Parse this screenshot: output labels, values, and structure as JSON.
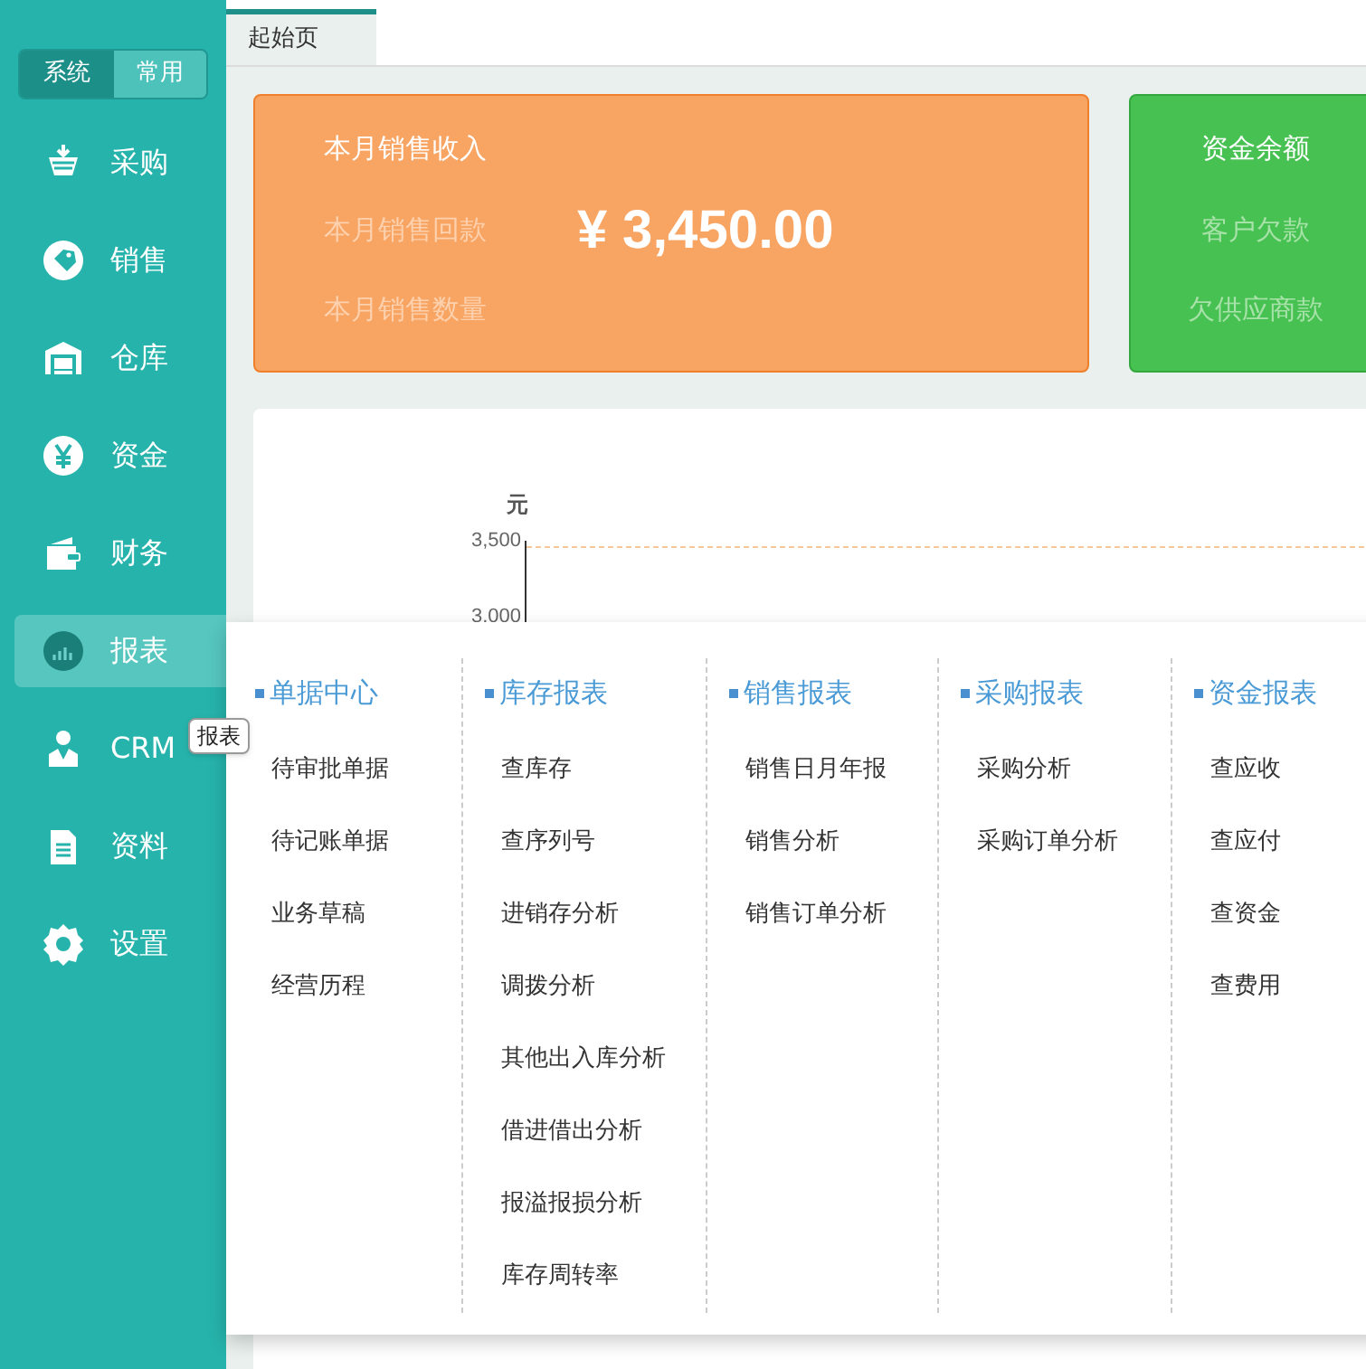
{
  "mode_switch": [
    {
      "label": "系统",
      "selected": true
    },
    {
      "label": "常用",
      "selected": false
    }
  ],
  "nav": [
    {
      "label": "采购",
      "selected": false
    },
    {
      "label": "销售",
      "selected": false
    },
    {
      "label": "仓库",
      "selected": false
    },
    {
      "label": "资金",
      "selected": false
    },
    {
      "label": "财务",
      "selected": false
    },
    {
      "label": "报表",
      "selected": true
    },
    {
      "label": "CRM",
      "selected": false
    },
    {
      "label": "资料",
      "selected": false
    },
    {
      "label": "设置",
      "selected": false
    }
  ],
  "tooltip": "报表",
  "page_tabs": [
    {
      "label": "起始页",
      "selected": true
    }
  ],
  "sales_card": {
    "title": "本月销售收入",
    "rows": [
      "本月销售回款",
      "本月销售数量"
    ],
    "amount": "¥ 3,450.00"
  },
  "funds_card": {
    "title": "资金余额",
    "rows": [
      "客户欠款",
      "欠供应商款"
    ]
  },
  "chart": {
    "unit": "元",
    "ticks": [
      "3,500",
      "3,000"
    ]
  },
  "menu": [
    {
      "title": "单据中心",
      "items": [
        "待审批单据",
        "待记账单据",
        "业务草稿",
        "经营历程"
      ]
    },
    {
      "title": "库存报表",
      "items": [
        "查库存",
        "查序列号",
        "进销存分析",
        "调拨分析",
        "其他出入库分析",
        "借进借出分析",
        "报溢报损分析",
        "库存周转率"
      ]
    },
    {
      "title": "销售报表",
      "items": [
        "销售日月年报",
        "销售分析",
        "销售订单分析"
      ]
    },
    {
      "title": "采购报表",
      "items": [
        "采购分析",
        "采购订单分析"
      ]
    },
    {
      "title": "资金报表",
      "items": [
        "查应收",
        "查应付",
        "查资金",
        "查费用"
      ]
    }
  ]
}
